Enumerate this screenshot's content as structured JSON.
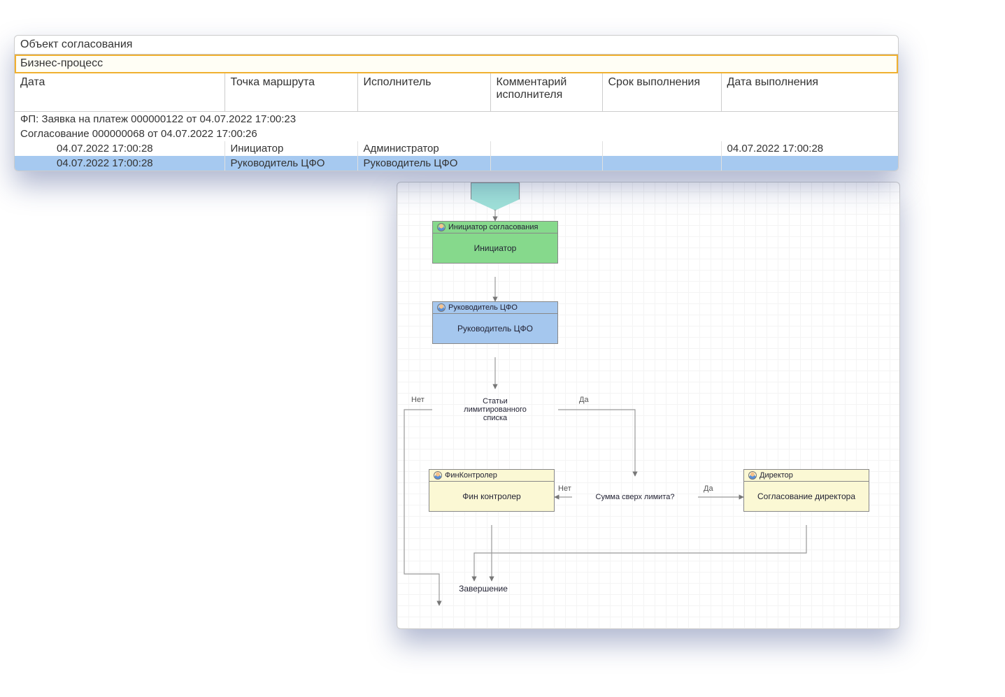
{
  "table": {
    "header1": "Объект согласования",
    "header2": "Бизнес-процесс",
    "columns": [
      "Дата",
      "Точка маршрута",
      "Исполнитель",
      "Комментарий исполнителя",
      "Срок выполнения",
      "Дата выполнения"
    ],
    "group_row": "ФП: Заявка на платеж 000000122 от 04.07.2022 17:00:23",
    "subgroup_row": "Согласование 000000068 от 04.07.2022 17:00:26",
    "rows": [
      {
        "date": "04.07.2022 17:00:28",
        "point": "Инициатор",
        "executor": "Администратор",
        "comment": "",
        "due": "",
        "done": "04.07.2022 17:00:28",
        "selected": false
      },
      {
        "date": "04.07.2022 17:00:28",
        "point": "Руководитель ЦФО",
        "executor": "Руководитель ЦФО",
        "comment": "",
        "due": "",
        "done": "",
        "selected": true
      }
    ]
  },
  "flow": {
    "nodes": {
      "initiator_title": "Инициатор согласования",
      "initiator_body": "Инициатор",
      "manager_title": "Руководитель ЦФО",
      "manager_body": "Руководитель ЦФО",
      "decision1": "Статьи лимитированного списка",
      "fincontrol_title": "ФинКонтролер",
      "fincontrol_body": "Фин контролер",
      "decision2": "Сумма сверх лимита?",
      "director_title": "Директор",
      "director_body": "Согласование директора",
      "end": "Завершение"
    },
    "labels": {
      "no": "Нет",
      "yes": "Да"
    }
  }
}
